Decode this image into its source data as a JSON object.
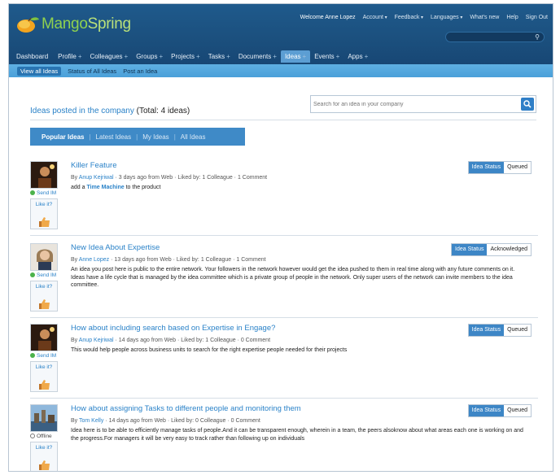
{
  "brand": {
    "name_part1": "Mango",
    "name_part2": "Spring"
  },
  "topnav": {
    "welcome_prefix": "Welcome",
    "user": "Anne Lopez",
    "items": [
      "Account",
      "Feedback",
      "Languages",
      "What's new",
      "Help",
      "Sign Out"
    ]
  },
  "mainnav": [
    {
      "label": "Dashboard",
      "plus": ""
    },
    {
      "label": "Profile",
      "plus": "+"
    },
    {
      "label": "Colleagues",
      "plus": "+"
    },
    {
      "label": "Groups",
      "plus": "+"
    },
    {
      "label": "Projects",
      "plus": "+"
    },
    {
      "label": "Tasks",
      "plus": "+"
    },
    {
      "label": "Documents",
      "plus": "+"
    },
    {
      "label": "Ideas",
      "plus": "+"
    },
    {
      "label": "Events",
      "plus": "+"
    },
    {
      "label": "Apps",
      "plus": "+"
    }
  ],
  "mainnav_active": "Ideas",
  "subnav": [
    "View all Ideas",
    "Status of All Ideas",
    "Post an Idea"
  ],
  "page": {
    "title": "Ideas posted in the company",
    "total": "(Total: 4 ideas)",
    "search_placeholder": "Search for an idea in your company"
  },
  "tabs": [
    "Popular Ideas",
    "Latest Ideas",
    "My Ideas",
    "All Ideas"
  ],
  "ideas": [
    {
      "title": "Killer Feature",
      "by": "By",
      "author": "Anup Kejriwal",
      "meta": "· 3 days ago from Web · Liked by: 1 Colleague · 1 Comment",
      "desc_before": "add a",
      "desc_link": "Time Machine",
      "desc_after": "to the product",
      "presence": "Send IM",
      "like": "Like it?",
      "status_label": "Idea Status",
      "status": "Queued"
    },
    {
      "title": "New Idea About Expertise",
      "by": "By",
      "author": "Anne Lopez",
      "meta": "· 13 days ago from Web · Liked by: 1 Colleague · 1 Comment",
      "desc": "An idea you post here is public to the entire network. Your followers in the network however would get the idea pushed to them in real time along with any future comments on it. Ideas have a life cycle that is managed by the idea committee which is a private group of people in the network. Only super users of the network can invite members to the idea committee.",
      "presence": "Send IM",
      "like": "Like it?",
      "status_label": "Idea Status",
      "status": "Acknowledged"
    },
    {
      "title": "How about including search based on Expertise in Engage?",
      "by": "By",
      "author": "Anup Kejriwal",
      "meta": "· 14 days ago from Web · Liked by: 1 Colleague · 0 Comment",
      "desc": "This would help people across business units to search for the right expertise people needed for their projects",
      "presence": "Send IM",
      "like": "Like it?",
      "status_label": "Idea Status",
      "status": "Queued"
    },
    {
      "title": "How about assigning Tasks to different people and monitoring them",
      "by": "By",
      "author": "Tom Kelly",
      "meta": "· 14 days ago from Web · Liked by: 0 Colleague · 0 Comment",
      "desc": "Idea here is to be able to efficiently manage tasks of people.And it can be transparent enough, wherein in a team, the peers alsoknow about what areas each one is working on and the progress.For managers it will be very easy to track rather than following up on individuals",
      "presence": "Offline",
      "like": "Like it?",
      "status_label": "Idea Status",
      "status": "Queued"
    }
  ],
  "colors": {
    "header": "#1b4f7d",
    "accent": "#2a82c8",
    "subnav": "#4aa0d9",
    "logo_green": "#8fd14f"
  }
}
